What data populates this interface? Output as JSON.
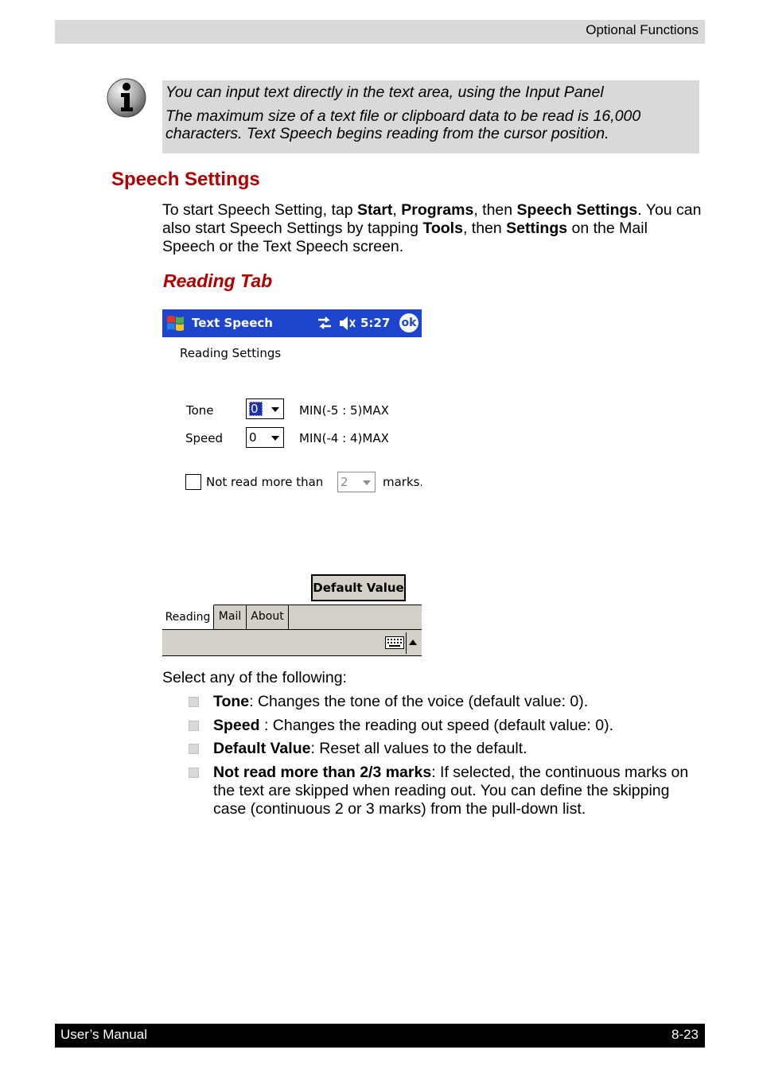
{
  "header": {
    "section": "Optional Functions"
  },
  "note": {
    "line1": "You can input text directly in the text area, using the Input Panel",
    "line2": "The maximum size of a text file or clipboard data to be read is 16,000 characters. Text Speech begins reading from the cursor position."
  },
  "speech_settings": {
    "heading": "Speech Settings",
    "p_a": "To start Speech Setting, tap ",
    "start": "Start",
    "comma": ", ",
    "programs": "Programs",
    "p_b": ", then ",
    "speech_settings": "Speech Settings",
    "p_c": ". You can also start Speech Settings by tapping ",
    "tools": "Tools",
    "p_d": ", then ",
    "settings": "Settings",
    "p_e": " on the Mail Speech or the Text Speech screen."
  },
  "reading_tab_heading": "Reading Tab",
  "device": {
    "app_title": "Text Speech",
    "time": "5:27",
    "ok_label": "ok",
    "section_label": "Reading Settings",
    "tone_label": "Tone",
    "tone_value": "0",
    "tone_range": "MIN(-5 : 5)MAX",
    "speed_label": "Speed",
    "speed_value": "0",
    "speed_range": "MIN(-4 : 4)MAX",
    "not_read_label": "Not read more than",
    "marks_value": "2",
    "marks_label": "marks.",
    "default_button": "Default Value",
    "tabs": [
      "Reading",
      "Mail",
      "About"
    ],
    "colors": {
      "titlebar": "#1c44cc",
      "chrome": "#d4d0c8"
    }
  },
  "select_intro": "Select any of the following:",
  "bullets": [
    {
      "term": "Tone",
      "desc": ": Changes the tone of the voice (default value: 0)."
    },
    {
      "term": "Speed",
      "desc": " : Changes the reading out speed (default value: 0)."
    },
    {
      "term": "Default Value",
      "desc": ": Reset all values to the default."
    },
    {
      "term": "Not read more than 2/3 marks",
      "desc": ": If selected, the continuous marks on the text are skipped when reading out. You can define the skipping case (continuous 2 or 3 marks) from the pull-down list."
    }
  ],
  "footer": {
    "left": "User’s Manual",
    "right": "8-23"
  },
  "colors": {
    "heading": "#b00000",
    "band": "#d9d9d9"
  }
}
